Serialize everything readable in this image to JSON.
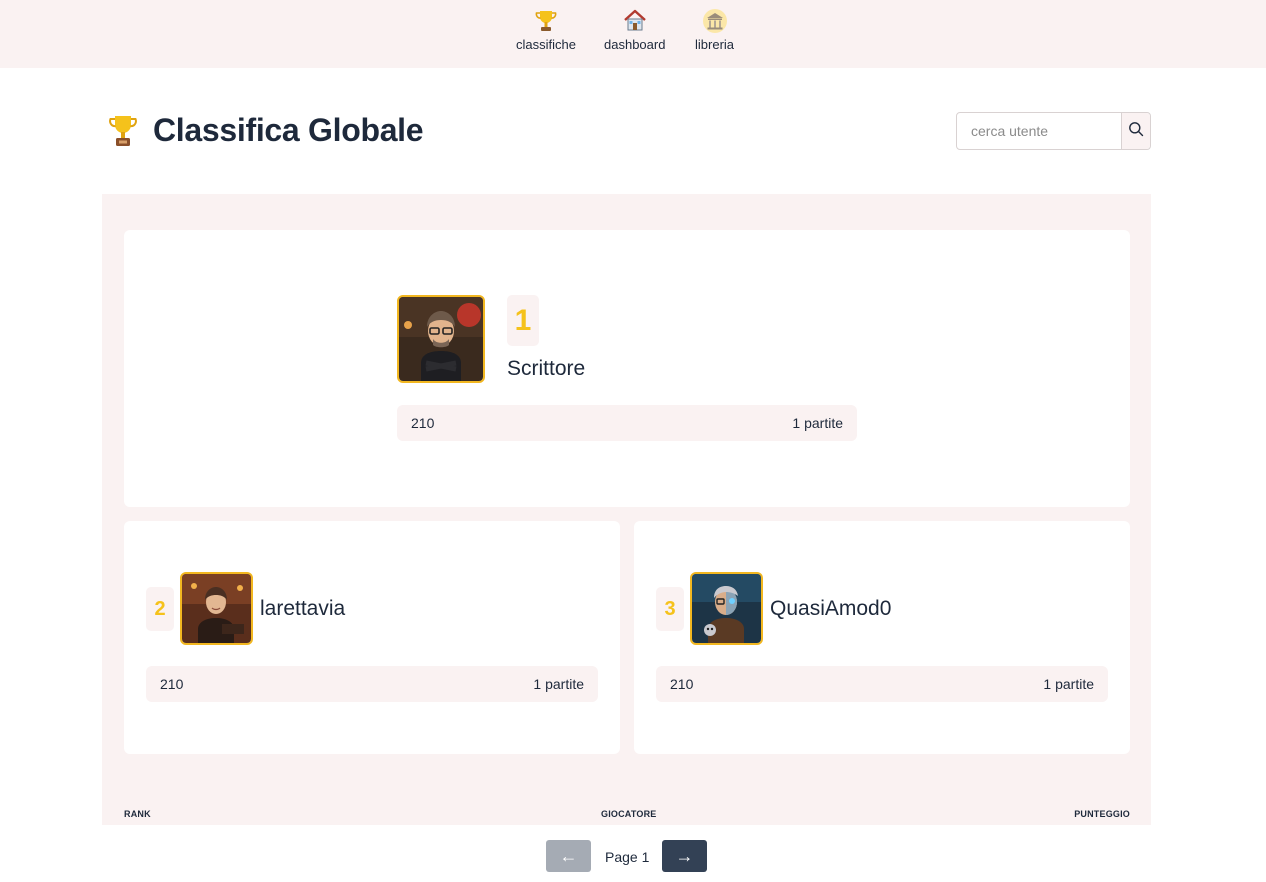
{
  "nav": {
    "items": [
      {
        "label": "classifiche",
        "icon": "trophy-icon"
      },
      {
        "label": "dashboard",
        "icon": "house-icon"
      },
      {
        "label": "libreria",
        "icon": "library-icon"
      }
    ]
  },
  "header": {
    "title": "Classifica Globale",
    "title_icon": "trophy-icon"
  },
  "search": {
    "placeholder": "cerca utente",
    "value": "",
    "button_icon": "search-icon"
  },
  "podium": [
    {
      "rank": "1",
      "name": "Scrittore",
      "score": "210",
      "games": "1 partite"
    },
    {
      "rank": "2",
      "name": "larettavia",
      "score": "210",
      "games": "1 partite"
    },
    {
      "rank": "3",
      "name": "QuasiAmod0",
      "score": "210",
      "games": "1 partite"
    }
  ],
  "table": {
    "columns": [
      "RANK",
      "GIOCATORE",
      "PUNTEGGIO"
    ]
  },
  "pagination": {
    "prev_label": "←",
    "page_label": "Page 1",
    "next_label": "→"
  },
  "colors": {
    "accent_gold": "#f5c21b",
    "soft_bg": "#faf2f2",
    "text_dark": "#1e293b",
    "button_dark": "#334155"
  }
}
